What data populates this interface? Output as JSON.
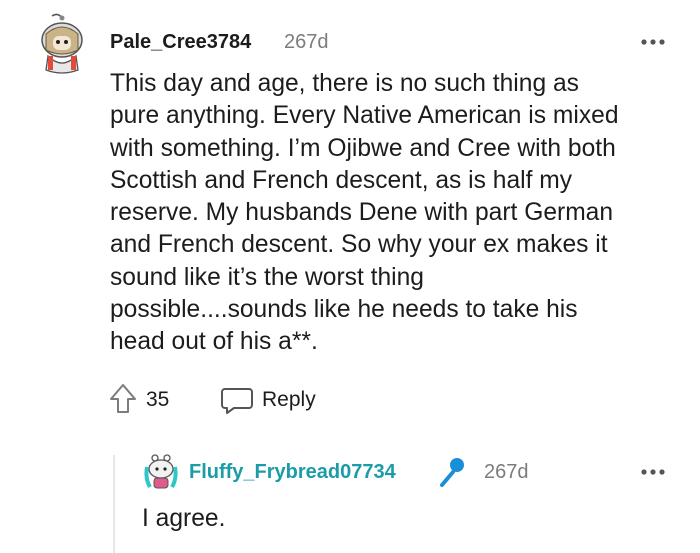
{
  "comment": {
    "username": "Pale_Cree3784",
    "age": "267d",
    "lines": [
      "This day and age, there is no such thing as",
      "pure anything. Every Native American is mixed",
      "with something. I’m Ojibwe and Cree with both",
      "Scottish and French descent, as is half my",
      "reserve. My husbands Dene with part German",
      "and French descent. So why your ex makes it",
      "sound like it’s the worst thing",
      "possible....sounds like he needs to take his",
      "head out of his a**."
    ],
    "score": "35",
    "reply_label": "Reply"
  },
  "reply": {
    "username": "Fluffy_Frybread07734",
    "age": "267d",
    "body": "I agree."
  },
  "colors": {
    "username_reply": "#1b9ca7",
    "mic_flair": "#1a8fd8",
    "meta_gray": "#7c7c7c",
    "thread_line": "#e6e6e6"
  },
  "icons": {
    "avatar1": "snoo-avatar",
    "upvote": "upvote-arrow-icon",
    "reply": "speech-bubble-icon",
    "more": "more-dots-icon",
    "mic": "microphone-icon",
    "avatar2": "snoo-avatar"
  }
}
